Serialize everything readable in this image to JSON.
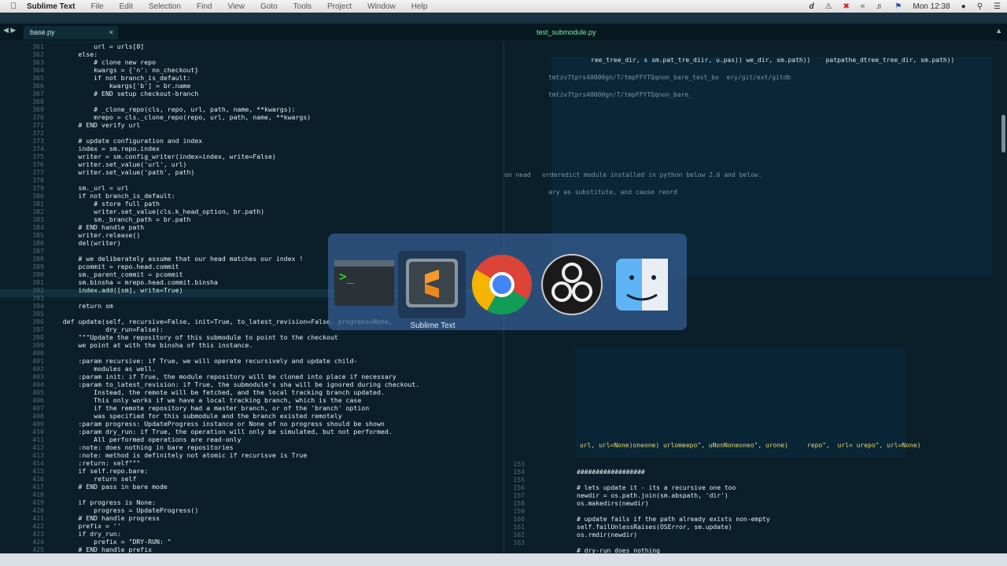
{
  "menubar": {
    "app_name": "Sublime Text",
    "items": [
      "File",
      "Edit",
      "Selection",
      "Find",
      "View",
      "Goto",
      "Tools",
      "Project",
      "Window",
      "Help"
    ],
    "clock": "Mon 12:38"
  },
  "tabs": {
    "left_active": "base.py",
    "left_close": "×",
    "right_active": "test_submodule.py"
  },
  "gutter_numbers": [
    "361",
    "362",
    "363",
    "364",
    "365",
    "366",
    "367",
    "368",
    "369",
    "370",
    "371",
    "372",
    "373",
    "374",
    "375",
    "376",
    "377",
    "378",
    "379",
    "380",
    "381",
    "382",
    "383",
    "384",
    "385",
    "386",
    "387",
    "388",
    "389",
    "390",
    "391",
    "392",
    "393",
    "394",
    "395",
    "396",
    "397",
    "398",
    "399",
    "400",
    "401",
    "402",
    "403",
    "404",
    "405",
    "406",
    "407",
    "408",
    "409",
    "410",
    "411",
    "412",
    "413",
    "414",
    "415",
    "416",
    "417",
    "418",
    "419",
    "420",
    "421",
    "422",
    "423",
    "424",
    "425"
  ],
  "code_lines": [
    "            url = urls[0]",
    "        else:",
    "            # clone new repo",
    "            kwargs = {'n': no_checkout}",
    "            if not branch_is_default:",
    "                kwargs['b'] = br.name",
    "            # END setup checkout-branch",
    "",
    "            # _clone_repo(cls, repo, url, path, name, **kwargs):",
    "            mrepo = cls._clone_repo(repo, url, path, name, **kwargs)",
    "        # END verify url",
    "",
    "        # update configuration and index",
    "        index = sm.repo.index",
    "        writer = sm.config_writer(index=index, write=False)",
    "        writer.set_value('url', url)",
    "        writer.set_value('path', path)",
    "",
    "        sm._url = url",
    "        if not branch_is_default:",
    "            # store full path",
    "            writer.set_value(cls.k_head_option, br.path)",
    "            sm._branch_path = br.path",
    "        # END handle path",
    "        writer.release()",
    "        del(writer)",
    "",
    "        # we deliberately assume that our head matches our index !",
    "        pcommit = repo.head.commit",
    "        sm._parent_commit = pcommit",
    "        sm.binsha = mrepo.head.commit.binsha",
    "        index.add([sm], write=True)",
    "",
    "        return sm",
    "",
    "    def update(self, recursive=False, init=True, to_latest_revision=False, progress=None,",
    "               dry_run=False):",
    "        \"\"\"Update the repository of this submodule to point to the checkout",
    "        we point at with the binsha of this instance.",
    "",
    "        :param recursive: if True, we will operate recursively and update child-",
    "            modules as well.",
    "        :param init: if True, the module repository will be cloned into place if necessary",
    "        :param to_latest_revision: if True, the submodule's sha will be ignored during checkout.",
    "            Instead, the remote will be fetched, and the local tracking branch updated.",
    "            This only works if we have a local tracking branch, which is the case",
    "            if the remote repository had a master branch, or of the 'branch' option",
    "            was specified for this submodule and the branch existed remotely",
    "        :param progress: UpdateProgress instance or None of no progress should be shown",
    "        :param dry_run: if True, the operation will only be simulated, but not performed.",
    "            All performed operations are read-only",
    "        :note: does nothing in bare repositories",
    "        :note: method is definitely not atomic if recurisve is True",
    "        :return: self\"\"\"",
    "        if self.repo.bare:",
    "            return self",
    "        # END pass in bare mode",
    "",
    "        if progress is None:",
    "            progress = UpdateProgress()",
    "        # END handle progress",
    "        prefix = ''",
    "        if dry_run:",
    "            prefix = \"DRY-RUN: \"",
    "        # END handle prefix"
  ],
  "right_pane": {
    "top_lines": [
      "ree_tree_dir, s sm.pat_tre_diir, u.pas)) we_dir, sm.path))    patpathe_dtree_tree_dir, sm.path))",
      "tmtzv7tprs40000gn/T/tmpFFYTQqnon_bare_test_bo  ery/git/ext/gitdb",
      "tmtzv7tprs40000gn/T/tmpFFYTQqnon_bare_",
      "on nead   orderedict module installed in python below 2.6 and below.",
      "ary as substitute, and cause reord"
    ],
    "mid_line": "url, url=None)oneone) urlomeepo\", uNonNoneoneo\", urone)     repo\",  url= urepo\", url=None)",
    "bottom_numbers": [
      "153",
      "154",
      "155",
      "156",
      "157",
      "158",
      "159",
      "160",
      "161",
      "162",
      "163"
    ],
    "bottom_lines": [
      "",
      "##################",
      "",
      "# lets update it - its a recursive one too",
      "newdir = os.path.join(sm.abspath, 'dir')",
      "os.makedirs(newdir)",
      "",
      "# update fails if the path already exists non-empty",
      "self.failUnlessRaises(OSError, sm.update)",
      "os.rmdir(newdir)",
      "",
      "# dry-run does nothing"
    ]
  },
  "app_switcher": {
    "apps": [
      "Terminal",
      "Sublime Text",
      "Google Chrome",
      "OBS",
      "Finder"
    ],
    "selected_label": "Sublime Text"
  },
  "colors": {
    "background": "#0a1f2a",
    "switcher": "#375f96"
  }
}
